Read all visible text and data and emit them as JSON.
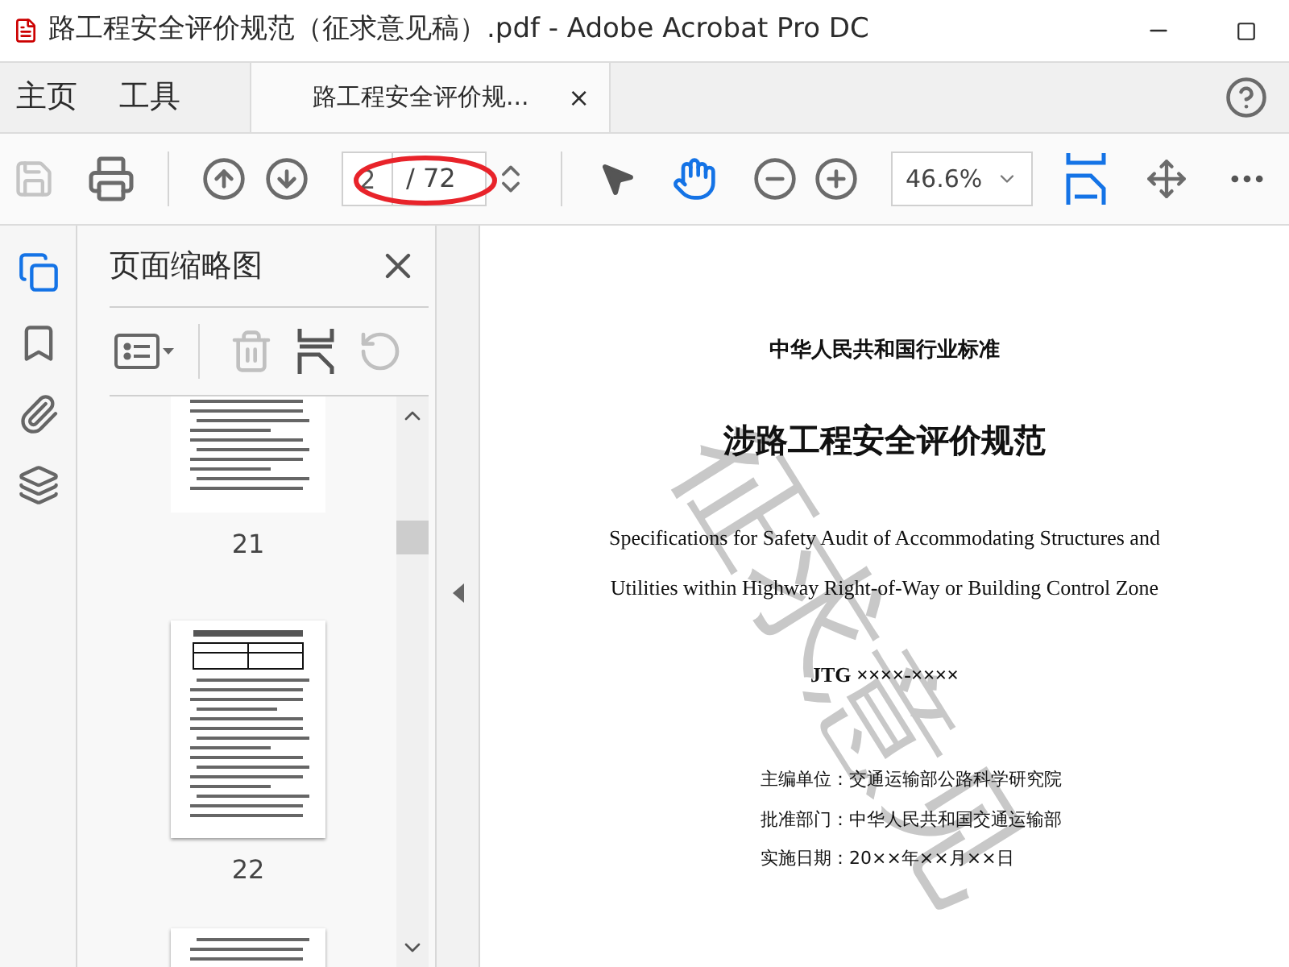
{
  "window": {
    "title": "路工程安全评价规范（征求意见稿）.pdf - Adobe Acrobat Pro DC"
  },
  "nav_tabs": [
    {
      "label": "主页",
      "selected": false
    },
    {
      "label": "工具",
      "selected": false
    }
  ],
  "document_tab": {
    "label": "路工程安全评价规...",
    "close": "×",
    "selected": true
  },
  "toolbar": {
    "page_input": {
      "value": "2"
    },
    "page_total": "/ 72",
    "zoom": {
      "value": "46.6%"
    },
    "hand_tool": {
      "selected": true
    },
    "fit_width": {
      "selected": true
    }
  },
  "sidebar_icons": [
    {
      "kind": "pages",
      "selected": true
    },
    {
      "kind": "bookmarks",
      "selected": false
    },
    {
      "kind": "attachments",
      "selected": false
    },
    {
      "kind": "layers",
      "selected": false
    }
  ],
  "thumbnails_panel": {
    "title": "页面缩略图",
    "thumbnails": [
      {
        "label": "21",
        "kind": "text"
      },
      {
        "label": "22",
        "kind": "table"
      }
    ]
  },
  "document": {
    "watermark": "征求意见",
    "lines": [
      {
        "kind": "org",
        "text": "中华人民共和国行业标准"
      },
      {
        "kind": "title",
        "text": "涉路工程安全评价规范"
      },
      {
        "kind": "english",
        "text": "Specifications for Safety Audit of Accommodating Structures and"
      },
      {
        "kind": "english",
        "text": "Utilities within Highway Right-of-Way or Building Control Zone"
      },
      {
        "kind": "code",
        "text": "JTG ××××-××××"
      },
      {
        "kind": "meta",
        "text": "主编单位：交通运输部公路科学研究院"
      },
      {
        "kind": "meta",
        "text": "批准部门：中华人民共和国交通运输部"
      },
      {
        "kind": "meta",
        "text": "实施日期：20××年××月××日"
      }
    ]
  }
}
